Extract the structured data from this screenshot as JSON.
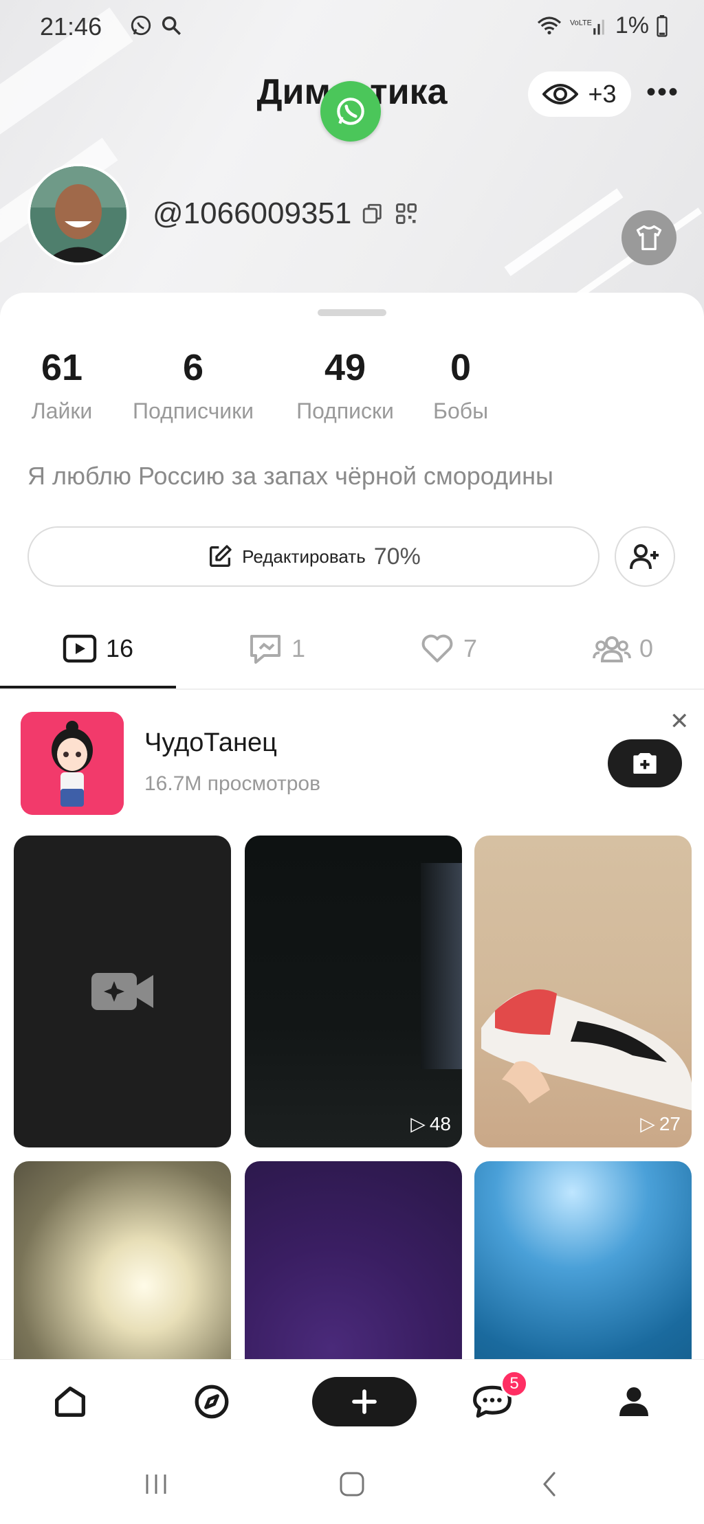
{
  "status_bar": {
    "time": "21:46",
    "battery": "1%"
  },
  "header": {
    "title": "Димастика",
    "visitors": "+3",
    "user_id": "@1066009351"
  },
  "stats": [
    {
      "value": "61",
      "label": "Лайки"
    },
    {
      "value": "6",
      "label": "Подписчики"
    },
    {
      "value": "49",
      "label": "Подписки"
    },
    {
      "value": "0",
      "label": "Бобы"
    }
  ],
  "bio": "Я люблю Россию за запах чёрной смородины",
  "edit": {
    "label": "Редактировать",
    "progress": "70%"
  },
  "tabs": [
    {
      "icon": "video-icon",
      "count": "16"
    },
    {
      "icon": "repost-icon",
      "count": "1"
    },
    {
      "icon": "heart-icon",
      "count": "7"
    },
    {
      "icon": "group-icon",
      "count": "0"
    }
  ],
  "promo": {
    "title": "ЧудоТанец",
    "views": "16.7M просмотров"
  },
  "videos": [
    {
      "views": ""
    },
    {
      "views": "48"
    },
    {
      "views": "27"
    },
    {
      "views": ""
    },
    {
      "views": ""
    },
    {
      "views": ""
    }
  ],
  "nav": {
    "chat_badge": "5"
  },
  "colors": {
    "accent": "#ff2e63",
    "whatsapp": "#4bc65a",
    "promo_bg": "#f23a6b"
  }
}
